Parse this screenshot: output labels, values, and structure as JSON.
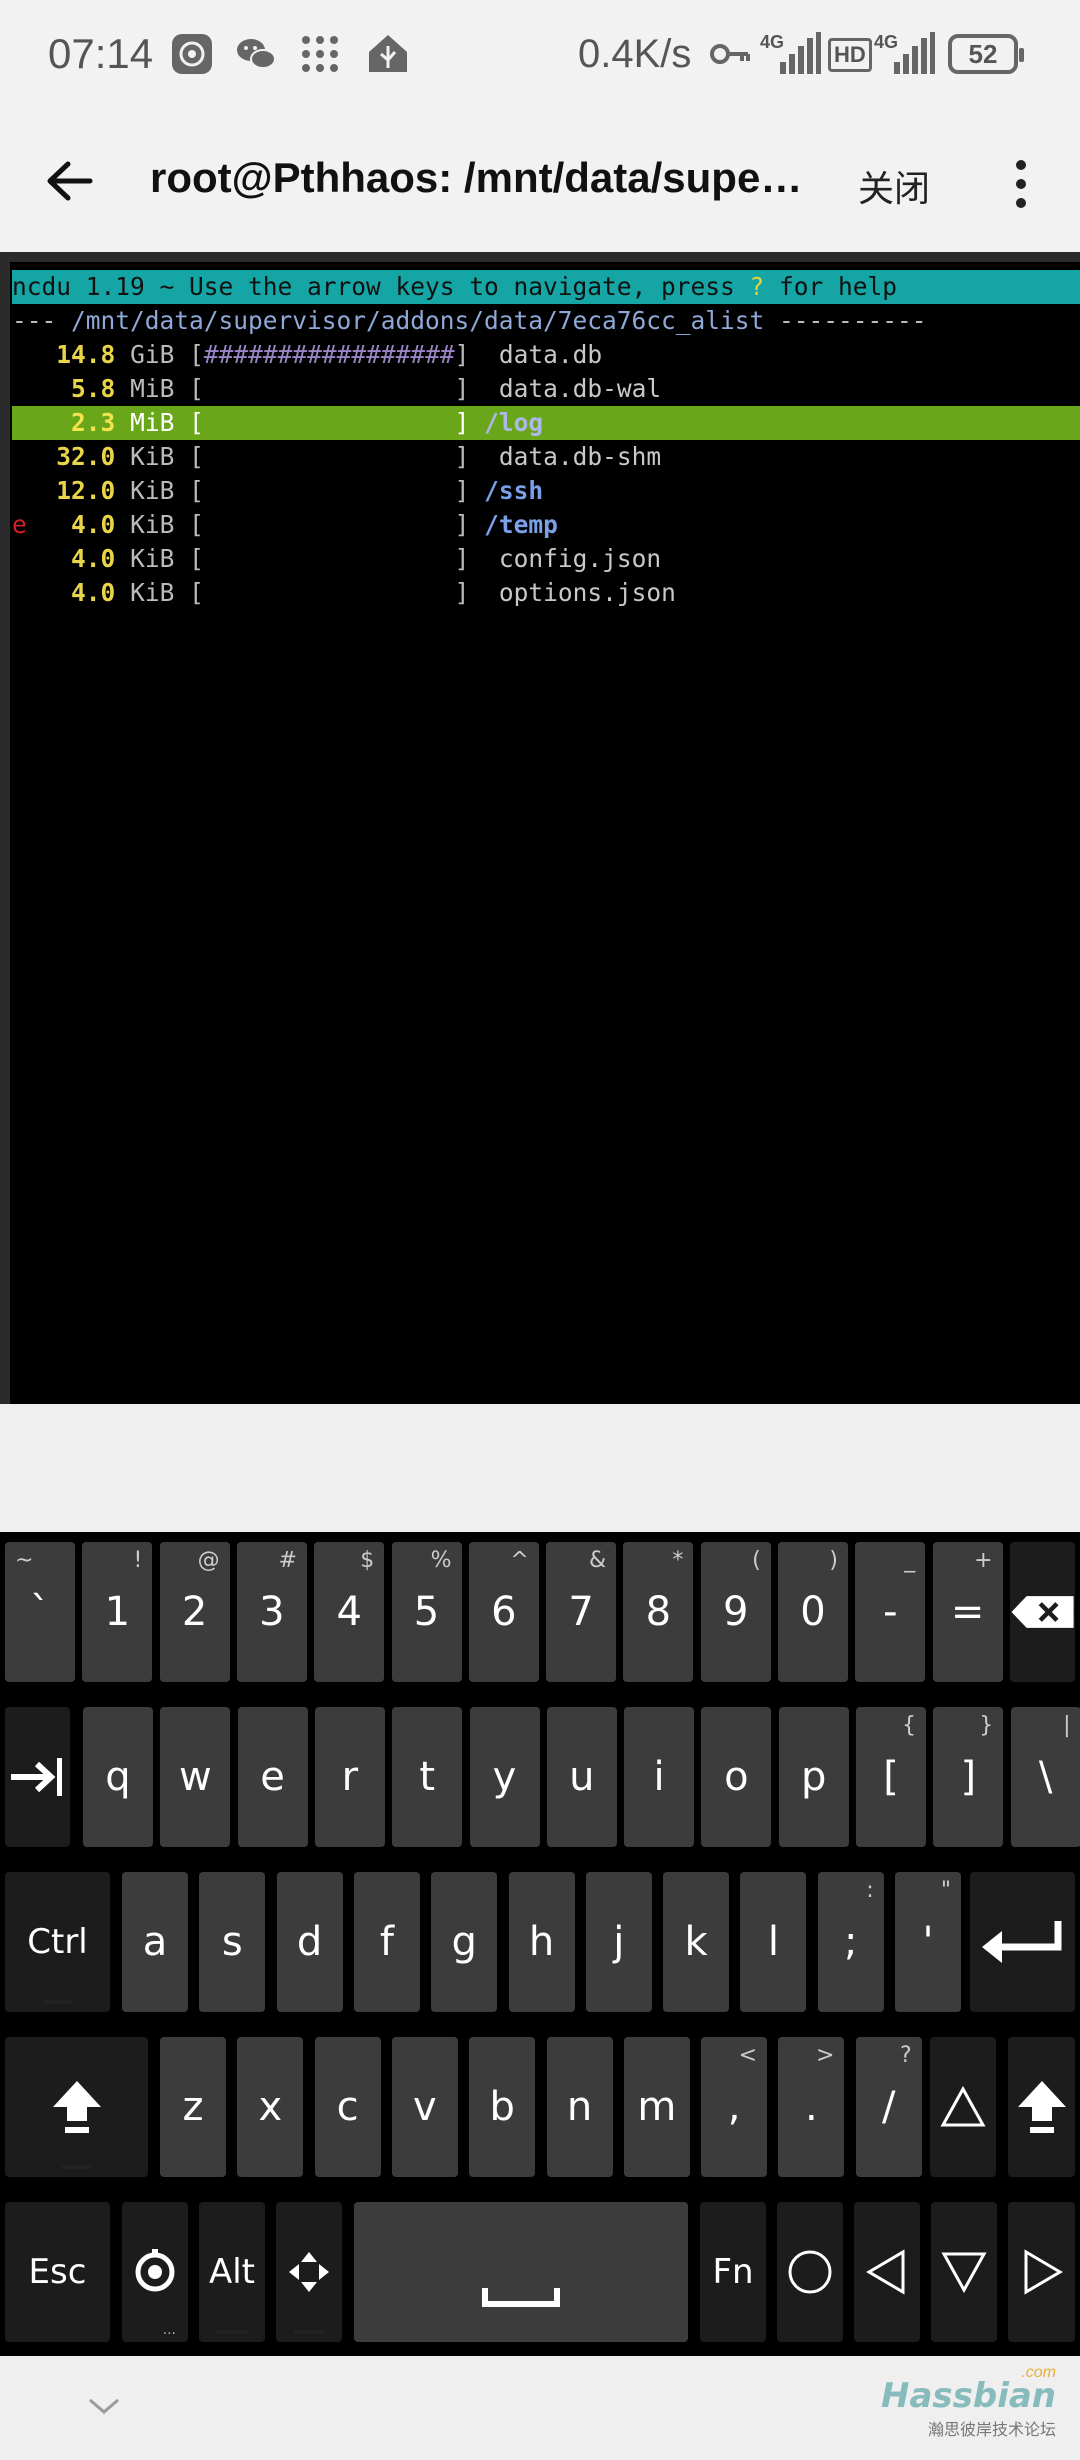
{
  "status_bar": {
    "time": "07:14",
    "net_speed": "0.4K/s",
    "net_type_1": "4G",
    "hd": "HD",
    "net_type_2": "4G",
    "battery": "52"
  },
  "app_bar": {
    "title": "root@Pthhaos: /mnt/data/supe…",
    "close_label": "关闭"
  },
  "terminal": {
    "header_pre": "ncdu 1.19 ~ Use the arrow keys to navigate, press ",
    "header_q": "?",
    "header_post": " for help",
    "dir_prefix": "--- ",
    "dir_path": "/mnt/data/supervisor/addons/data/7eca76cc_alist",
    "dir_suffix": " ----------",
    "rows": [
      {
        "flag": " ",
        "size": "14.8",
        "unit": "GiB",
        "bar": "#################",
        "name": "data.db",
        "is_dir": false,
        "selected": false
      },
      {
        "flag": " ",
        "size": "5.8",
        "unit": "MiB",
        "bar": "                 ",
        "name": "data.db-wal",
        "is_dir": false,
        "selected": false
      },
      {
        "flag": " ",
        "size": "2.3",
        "unit": "MiB",
        "bar": "                 ",
        "name": "/log",
        "is_dir": true,
        "selected": true
      },
      {
        "flag": " ",
        "size": "32.0",
        "unit": "KiB",
        "bar": "                 ",
        "name": "data.db-shm",
        "is_dir": false,
        "selected": false
      },
      {
        "flag": " ",
        "size": "12.0",
        "unit": "KiB",
        "bar": "                 ",
        "name": "/ssh",
        "is_dir": true,
        "selected": false
      },
      {
        "flag": "e",
        "size": "4.0",
        "unit": "KiB",
        "bar": "                 ",
        "name": "/temp",
        "is_dir": true,
        "selected": false
      },
      {
        "flag": " ",
        "size": "4.0",
        "unit": "KiB",
        "bar": "                 ",
        "name": "config.json",
        "is_dir": false,
        "selected": false
      },
      {
        "flag": " ",
        "size": "4.0",
        "unit": "KiB",
        "bar": "                 ",
        "name": "options.json",
        "is_dir": false,
        "selected": false
      }
    ]
  },
  "keyboard": {
    "row1": [
      {
        "main": "`",
        "alt": "~"
      },
      {
        "main": "1",
        "alt": "!"
      },
      {
        "main": "2",
        "alt": "@"
      },
      {
        "main": "3",
        "alt": "#"
      },
      {
        "main": "4",
        "alt": "$"
      },
      {
        "main": "5",
        "alt": "%"
      },
      {
        "main": "6",
        "alt": "^"
      },
      {
        "main": "7",
        "alt": "&"
      },
      {
        "main": "8",
        "alt": "*"
      },
      {
        "main": "9",
        "alt": "("
      },
      {
        "main": "0",
        "alt": ")"
      },
      {
        "main": "-",
        "alt": "_"
      },
      {
        "main": "=",
        "alt": "+"
      }
    ],
    "row2": [
      {
        "main": "q",
        "alt": ""
      },
      {
        "main": "w",
        "alt": ""
      },
      {
        "main": "e",
        "alt": ""
      },
      {
        "main": "r",
        "alt": ""
      },
      {
        "main": "t",
        "alt": ""
      },
      {
        "main": "y",
        "alt": ""
      },
      {
        "main": "u",
        "alt": ""
      },
      {
        "main": "i",
        "alt": ""
      },
      {
        "main": "o",
        "alt": ""
      },
      {
        "main": "p",
        "alt": ""
      },
      {
        "main": "[",
        "alt": "{"
      },
      {
        "main": "]",
        "alt": "}"
      },
      {
        "main": "\\",
        "alt": "|"
      }
    ],
    "row3": [
      {
        "main": "a",
        "alt": ""
      },
      {
        "main": "s",
        "alt": ""
      },
      {
        "main": "d",
        "alt": ""
      },
      {
        "main": "f",
        "alt": ""
      },
      {
        "main": "g",
        "alt": ""
      },
      {
        "main": "h",
        "alt": ""
      },
      {
        "main": "j",
        "alt": ""
      },
      {
        "main": "k",
        "alt": ""
      },
      {
        "main": "l",
        "alt": ""
      },
      {
        "main": ";",
        "alt": ":"
      },
      {
        "main": "'",
        "alt": "\""
      }
    ],
    "row4": [
      {
        "main": "z",
        "alt": ""
      },
      {
        "main": "x",
        "alt": ""
      },
      {
        "main": "c",
        "alt": ""
      },
      {
        "main": "v",
        "alt": ""
      },
      {
        "main": "b",
        "alt": ""
      },
      {
        "main": "n",
        "alt": ""
      },
      {
        "main": "m",
        "alt": ""
      },
      {
        "main": ",",
        "alt": "<"
      },
      {
        "main": ".",
        "alt": ">"
      },
      {
        "main": "/",
        "alt": "?"
      }
    ],
    "ctrl_label": "Ctrl",
    "esc_label": "Esc",
    "alt_label": "Alt",
    "fn_label": "Fn",
    "dots_label": "..."
  },
  "watermark": {
    "main": "Hassbian",
    "com": ".com",
    "sub": "瀚思彼岸技术论坛"
  }
}
